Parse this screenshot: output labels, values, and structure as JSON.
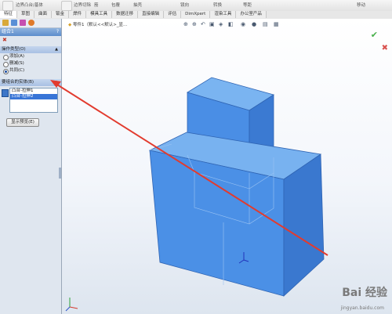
{
  "toolbar": {
    "items": [
      "边界凸台/基体",
      "边界切除",
      "筋",
      "包覆",
      "抽壳",
      "镜向",
      "转换",
      "等距",
      "移动"
    ]
  },
  "tabs": [
    "特征",
    "草图",
    "曲面",
    "钣金",
    "焊件",
    "模具工具",
    "数据迁移",
    "直接编辑",
    "评估",
    "DimXpert",
    "渲染工具",
    "办公室产品"
  ],
  "panel": {
    "title": "组合1",
    "help": "?",
    "close_label": "✖",
    "operation_section": "操作类型(O)",
    "options": [
      "添加(A)",
      "删减(S)",
      "共同(C)"
    ],
    "selected_option": 2,
    "bodies_section": "要组合的实体(B)",
    "bodies": [
      "凸台-拉伸1",
      "凸台-拉伸2"
    ],
    "show_preview": "显示预览(E)"
  },
  "viewport": {
    "breadcrumb": "零件1（默认<<默认>_显...",
    "ok_glyph": "✔",
    "cancel_glyph": "✖",
    "watermark": "Bai 经验",
    "watermark_url": "jingyan.baidu.com"
  },
  "colors": {
    "part_front": "#4b90e6",
    "part_side": "#3a78cf",
    "part_top": "#79b2f0",
    "arrow": "#e23b2e"
  }
}
